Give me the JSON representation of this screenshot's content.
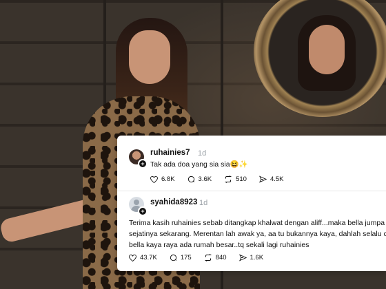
{
  "post1": {
    "username": "ruhainies7",
    "time": "1d",
    "text": "Tak ada doa yang sia sia😆✨",
    "likes": "6.8K",
    "comments": "3.6K",
    "reposts": "510",
    "shares": "4.5K"
  },
  "post2": {
    "username": "syahida8923",
    "time": "1d",
    "text_lines": [
      "Terima kasih ruhainies sebab ditangkap khalwat dengan aliff...maka bella jumpa c",
      "sejatinya sekarang. Merentan lah awak ya, aa tu bukannya kaya, dahlah selalu cu",
      "bella kaya raya ada rumah besar..tq sekali lagi ruhainies"
    ],
    "likes": "43.7K",
    "comments": "175",
    "reposts": "840",
    "shares": "1.6K"
  },
  "icons": [
    "heart-icon",
    "comment-icon",
    "repost-icon",
    "share-icon",
    "plus-icon"
  ],
  "colors": {
    "card_bg": "#ffffff",
    "muted_text": "#9aa0a6",
    "divider": "#e6e6e6"
  }
}
